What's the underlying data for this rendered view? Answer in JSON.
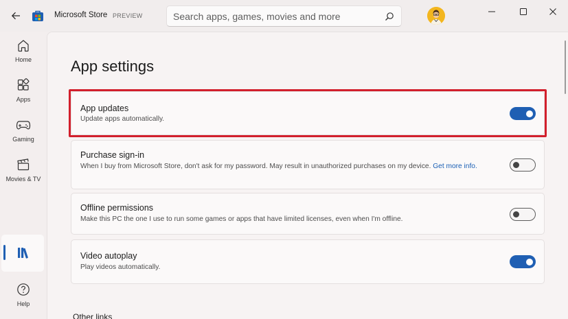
{
  "window": {
    "title": "Microsoft Store",
    "badge": "PREVIEW",
    "controls": [
      "minimize-icon",
      "maximize-icon",
      "close-icon"
    ]
  },
  "search": {
    "placeholder": "Search apps, games, movies and more",
    "value": ""
  },
  "sidebar": {
    "items": [
      {
        "label": "Home",
        "icon": "home-icon"
      },
      {
        "label": "Apps",
        "icon": "apps-icon"
      },
      {
        "label": "Gaming",
        "icon": "gamepad-icon"
      },
      {
        "label": "Movies & TV",
        "icon": "clapperboard-icon"
      },
      {
        "label": "",
        "icon": "library-icon",
        "selected": true
      },
      {
        "label": "Help",
        "icon": "help-icon"
      }
    ]
  },
  "page": {
    "title": "App settings",
    "settings": [
      {
        "title": "App updates",
        "description": "Update apps automatically.",
        "enabled": true,
        "highlighted": true
      },
      {
        "title": "Purchase sign-in",
        "description": "When I buy from Microsoft Store, don't ask for my password. May result in unauthorized purchases on my device.",
        "link": "Get more info.",
        "enabled": false
      },
      {
        "title": "Offline permissions",
        "description": "Make this PC the one I use to run some games or apps that have limited licenses, even when I'm offline.",
        "enabled": false
      },
      {
        "title": "Video autoplay",
        "description": "Play videos automatically.",
        "enabled": true
      }
    ],
    "other_links_heading": "Other links"
  },
  "colors": {
    "accent": "#1f5fb3",
    "highlight_border": "#d21f2c",
    "background": "#f3eeee"
  }
}
